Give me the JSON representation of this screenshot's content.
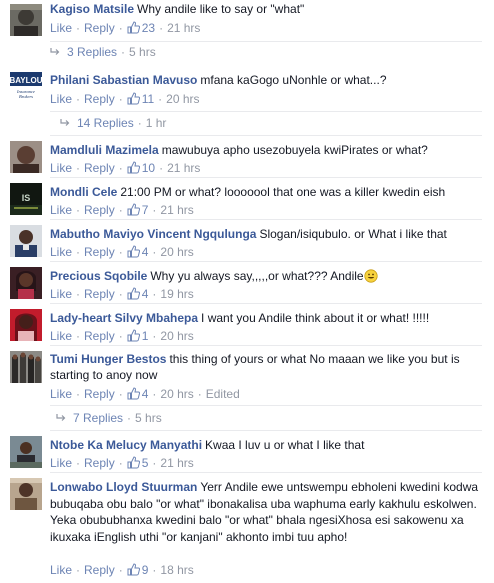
{
  "labels": {
    "like": "Like",
    "reply": "Reply",
    "dot": "·"
  },
  "comments": [
    {
      "name": "Kagiso Matsile",
      "text": "Why andile like to say or \"what\"",
      "likes": "23",
      "time": "21 hrs",
      "replies": "3 Replies",
      "replies_time": "5 hrs"
    },
    {
      "name": "Philani Sabastian Mavuso",
      "text": "mfana kaGogo uNonhle or what...?",
      "likes": "11",
      "time": "20 hrs",
      "replies": "14 Replies",
      "replies_time": "1 hr",
      "avatar_text": "BAYLOU",
      "avatar_sub": "Insurance Brokers"
    },
    {
      "name": "Mamdluli Mazimela",
      "text": "mawubuya apho usezobuyela kwiPirates or what?",
      "likes": "10",
      "time": "21 hrs"
    },
    {
      "name": "Mondli Cele",
      "text": "21:00 PM or what? looooool that one was a killer kwedin eish",
      "likes": "7",
      "time": "21 hrs",
      "avatar_text": "IS"
    },
    {
      "name": "Mabutho Maviyo Vincent Ngqulunga",
      "text": "Slogan/isiqubulo. or What i like that",
      "likes": "4",
      "time": "20 hrs"
    },
    {
      "name": "Precious Sqobile",
      "text": "Why yu always say,,,,,or what??? Andile",
      "likes": "4",
      "time": "19 hrs"
    },
    {
      "name": "Lady-heart Silvy Mbahepa",
      "text": "I want you Andile think about it or what! !!!!!",
      "likes": "1",
      "time": "20 hrs"
    },
    {
      "name": "Tumi Hunger Bestos",
      "text": "this thing of yours or what No maaan we like you but is starting to anoy now",
      "likes": "4",
      "time": "20 hrs",
      "edited": "Edited",
      "replies": "7 Replies",
      "replies_time": "5 hrs"
    },
    {
      "name": "Ntobe Ka Melucy Manyathi",
      "text": "Kwaa I luv u or what I like that",
      "likes": "5",
      "time": "21 hrs"
    },
    {
      "name": "Lonwabo Lloyd Stuurman",
      "text": "Yerr Andile ewe untswempu ebholeni kwedini kodwa bubuqaba obu balo \"or what\" ibonakalisa uba waphuma early kakhulu eskolwen. Yeka obububhanxa kwedini balo \"or what\" bhala ngesiXhosa esi sakowenu xa ikuxaka iEnglish uthi \"or kanjani\" akhonto imbi tuu apho!",
      "likes": "9",
      "time": "18 hrs"
    }
  ],
  "colors": {
    "name": "#3b5998",
    "link": "#6d84b4",
    "meta": "#9197a3",
    "divider": "#e9eaed"
  }
}
